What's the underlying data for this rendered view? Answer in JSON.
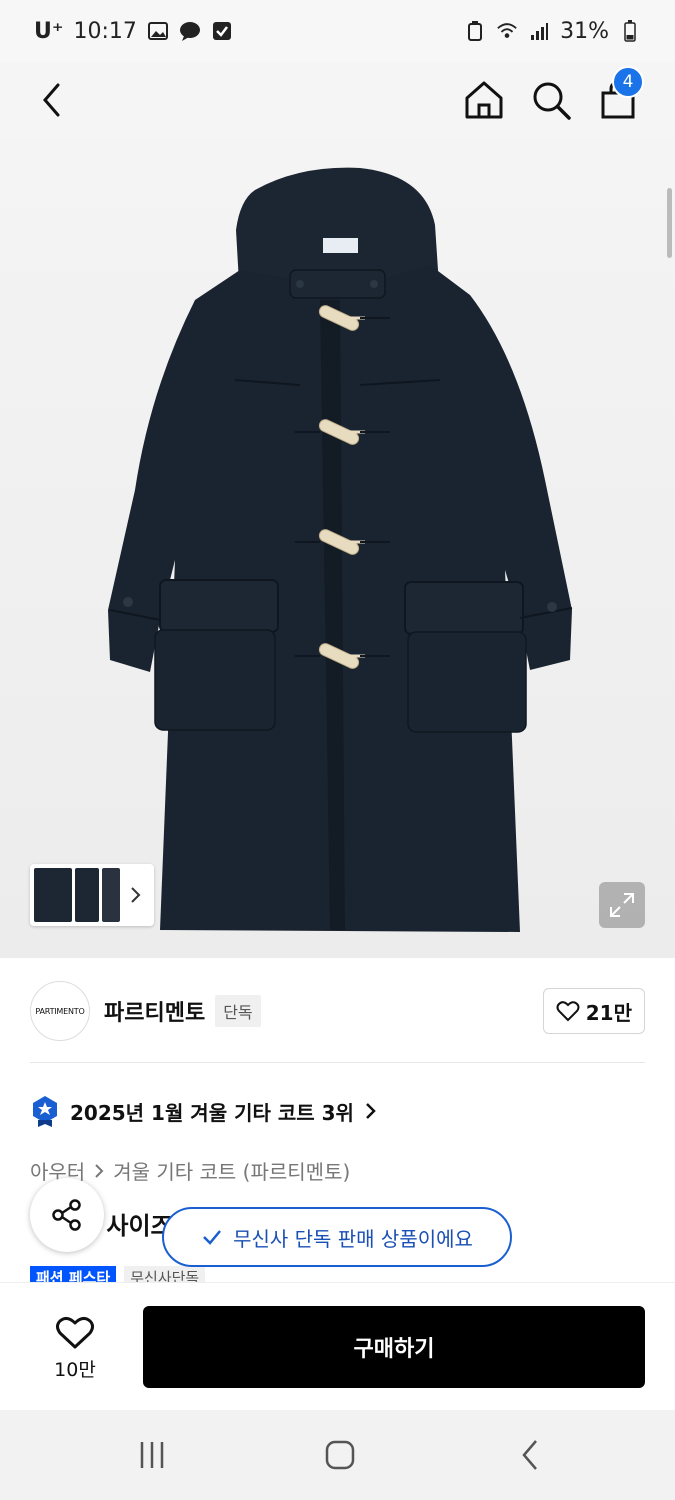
{
  "status_bar": {
    "carrier": "U⁺",
    "time": "10:17",
    "battery": "31%"
  },
  "nav": {
    "cart_count": "4"
  },
  "product": {
    "thumbnail_count": 3
  },
  "brand": {
    "logo_text": "PARTIMENTO",
    "name": "파르티멘토",
    "tag": "단독",
    "likes": "21만"
  },
  "ranking": {
    "text": "2025년 1월 겨울 기타 코트 3위"
  },
  "category": {
    "parent": "아우터",
    "child": "겨울 기타 코트 (파르티멘토)"
  },
  "title": {
    "visible_fragment_start": "",
    "visible_fragment": "사이즈"
  },
  "tags": {
    "event": "패션 페스타",
    "exclusive": "무신사단독"
  },
  "toast": {
    "message": "무신사 단독 판매 상품이에요"
  },
  "action_bar": {
    "wish_count": "10만",
    "buy_label": "구매하기"
  },
  "colors": {
    "accent_blue": "#1a73e8",
    "coat_navy": "#1d2733",
    "buy_black": "#000000",
    "toast_border": "#1a5fd1"
  }
}
